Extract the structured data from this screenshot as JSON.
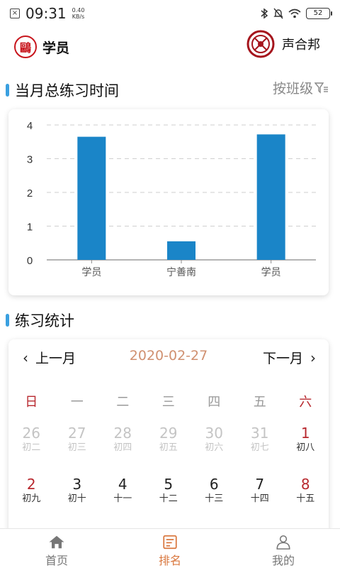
{
  "status_bar": {
    "time": "09:31",
    "speed_value": "0.40",
    "speed_unit": "KB/s",
    "battery": "52"
  },
  "header": {
    "user_label": "学员",
    "logo_char": "鷗",
    "org_name": "声合邦"
  },
  "monthly_section": {
    "title": "当月总练习时间",
    "filter_label": "按班级"
  },
  "chart_data": {
    "type": "bar",
    "categories": [
      "学员",
      "宁善南",
      "学员"
    ],
    "values": [
      3.65,
      0.55,
      3.72
    ],
    "ylim": [
      0,
      4
    ],
    "yticks": [
      "0",
      "1",
      "2",
      "3",
      "4"
    ],
    "grid": true,
    "bar_color": "#1a85c8"
  },
  "practice_section": {
    "title": "练习统计"
  },
  "calendar": {
    "prev_label": "上一月",
    "next_label": "下一月",
    "current_date": "2020-02-27",
    "weekdays": [
      "日",
      "一",
      "二",
      "三",
      "四",
      "五",
      "六"
    ],
    "weeks": [
      [
        {
          "day": "26",
          "lunar": "初二"
        },
        {
          "day": "27",
          "lunar": "初三"
        },
        {
          "day": "28",
          "lunar": "初四"
        },
        {
          "day": "29",
          "lunar": "初五"
        },
        {
          "day": "30",
          "lunar": "初六"
        },
        {
          "day": "31",
          "lunar": "初七"
        },
        {
          "day": "1",
          "lunar": "初八"
        }
      ],
      [
        {
          "day": "2",
          "lunar": "初九"
        },
        {
          "day": "3",
          "lunar": "初十"
        },
        {
          "day": "4",
          "lunar": "十一"
        },
        {
          "day": "5",
          "lunar": "十二"
        },
        {
          "day": "6",
          "lunar": "十三"
        },
        {
          "day": "7",
          "lunar": "十四"
        },
        {
          "day": "8",
          "lunar": "十五"
        }
      ]
    ]
  },
  "tabbar": {
    "home": "首页",
    "ranking": "排名",
    "mine": "我的"
  },
  "colors": {
    "accent": "#d9773e",
    "weekend_red": "#b8282e",
    "section_bar": "#3aa0e0"
  }
}
